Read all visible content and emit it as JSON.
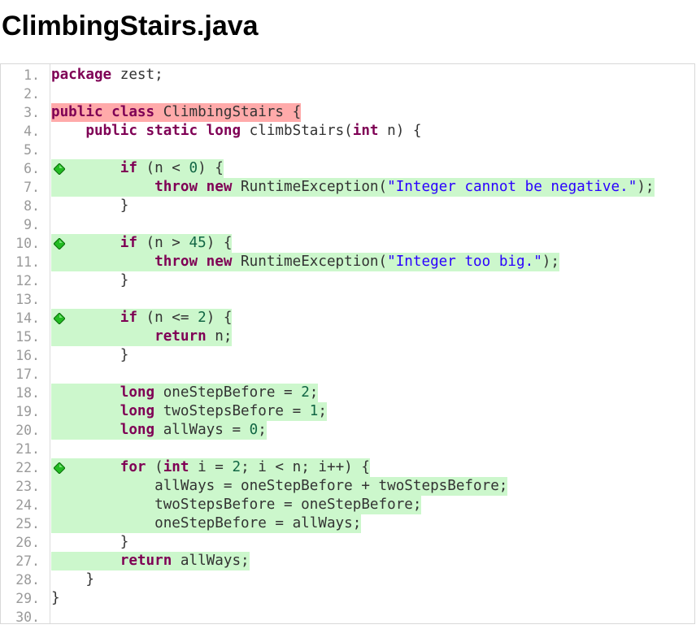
{
  "file": {
    "title": "ClimbingStairs.java"
  },
  "colors": {
    "covered": "#ccf7cc",
    "uncovered": "#ffaaaa",
    "keyword": "#7f0055",
    "string": "#2a00ff",
    "number": "#116644",
    "line_number": "#9a9a9a",
    "branch_marker": "#22bb22"
  },
  "lines": [
    {
      "n": "1.",
      "cov": "",
      "branch": false,
      "tokens": [
        [
          "kw",
          "package"
        ],
        [
          "t",
          " zest;"
        ]
      ]
    },
    {
      "n": "2.",
      "cov": "",
      "branch": false,
      "tokens": []
    },
    {
      "n": "3.",
      "cov": "partial",
      "branch": false,
      "tokens": [
        [
          "kw",
          "public class"
        ],
        [
          "t",
          " ClimbingStairs {"
        ]
      ]
    },
    {
      "n": "4.",
      "cov": "",
      "branch": false,
      "tokens": [
        [
          "t",
          "    "
        ],
        [
          "kw",
          "public static long"
        ],
        [
          "t",
          " climbStairs("
        ],
        [
          "kw",
          "int"
        ],
        [
          "t",
          " n) {"
        ]
      ]
    },
    {
      "n": "5.",
      "cov": "",
      "branch": false,
      "tokens": []
    },
    {
      "n": "6.",
      "cov": "full",
      "branch": true,
      "tokens": [
        [
          "t",
          "        "
        ],
        [
          "kw",
          "if"
        ],
        [
          "t",
          " (n < "
        ],
        [
          "num",
          "0"
        ],
        [
          "t",
          ") {"
        ]
      ]
    },
    {
      "n": "7.",
      "cov": "full",
      "branch": false,
      "tokens": [
        [
          "t",
          "            "
        ],
        [
          "kw",
          "throw new"
        ],
        [
          "t",
          " RuntimeException("
        ],
        [
          "str",
          "\"Integer cannot be negative.\""
        ],
        [
          "t",
          ");"
        ]
      ]
    },
    {
      "n": "8.",
      "cov": "",
      "branch": false,
      "tokens": [
        [
          "t",
          "        }"
        ]
      ]
    },
    {
      "n": "9.",
      "cov": "",
      "branch": false,
      "tokens": []
    },
    {
      "n": "10.",
      "cov": "full",
      "branch": true,
      "tokens": [
        [
          "t",
          "        "
        ],
        [
          "kw",
          "if"
        ],
        [
          "t",
          " (n > "
        ],
        [
          "num",
          "45"
        ],
        [
          "t",
          ") {"
        ]
      ]
    },
    {
      "n": "11.",
      "cov": "full",
      "branch": false,
      "tokens": [
        [
          "t",
          "            "
        ],
        [
          "kw",
          "throw new"
        ],
        [
          "t",
          " RuntimeException("
        ],
        [
          "str",
          "\"Integer too big.\""
        ],
        [
          "t",
          ");"
        ]
      ]
    },
    {
      "n": "12.",
      "cov": "",
      "branch": false,
      "tokens": [
        [
          "t",
          "        }"
        ]
      ]
    },
    {
      "n": "13.",
      "cov": "",
      "branch": false,
      "tokens": []
    },
    {
      "n": "14.",
      "cov": "full",
      "branch": true,
      "tokens": [
        [
          "t",
          "        "
        ],
        [
          "kw",
          "if"
        ],
        [
          "t",
          " (n <= "
        ],
        [
          "num",
          "2"
        ],
        [
          "t",
          ") {"
        ]
      ]
    },
    {
      "n": "15.",
      "cov": "full",
      "branch": false,
      "tokens": [
        [
          "t",
          "            "
        ],
        [
          "kw",
          "return"
        ],
        [
          "t",
          " n;"
        ]
      ]
    },
    {
      "n": "16.",
      "cov": "",
      "branch": false,
      "tokens": [
        [
          "t",
          "        }"
        ]
      ]
    },
    {
      "n": "17.",
      "cov": "",
      "branch": false,
      "tokens": []
    },
    {
      "n": "18.",
      "cov": "full",
      "branch": false,
      "tokens": [
        [
          "t",
          "        "
        ],
        [
          "kw",
          "long"
        ],
        [
          "t",
          " oneStepBefore = "
        ],
        [
          "num",
          "2"
        ],
        [
          "t",
          ";"
        ]
      ]
    },
    {
      "n": "19.",
      "cov": "full",
      "branch": false,
      "tokens": [
        [
          "t",
          "        "
        ],
        [
          "kw",
          "long"
        ],
        [
          "t",
          " twoStepsBefore = "
        ],
        [
          "num",
          "1"
        ],
        [
          "t",
          ";"
        ]
      ]
    },
    {
      "n": "20.",
      "cov": "full",
      "branch": false,
      "tokens": [
        [
          "t",
          "        "
        ],
        [
          "kw",
          "long"
        ],
        [
          "t",
          " allWays = "
        ],
        [
          "num",
          "0"
        ],
        [
          "t",
          ";"
        ]
      ]
    },
    {
      "n": "21.",
      "cov": "",
      "branch": false,
      "tokens": []
    },
    {
      "n": "22.",
      "cov": "full",
      "branch": true,
      "tokens": [
        [
          "t",
          "        "
        ],
        [
          "kw",
          "for"
        ],
        [
          "t",
          " ("
        ],
        [
          "kw",
          "int"
        ],
        [
          "t",
          " i = "
        ],
        [
          "num",
          "2"
        ],
        [
          "t",
          "; i < n; i++) {"
        ]
      ]
    },
    {
      "n": "23.",
      "cov": "full",
      "branch": false,
      "tokens": [
        [
          "t",
          "            allWays = oneStepBefore + twoStepsBefore;"
        ]
      ]
    },
    {
      "n": "24.",
      "cov": "full",
      "branch": false,
      "tokens": [
        [
          "t",
          "            twoStepsBefore = oneStepBefore;"
        ]
      ]
    },
    {
      "n": "25.",
      "cov": "full",
      "branch": false,
      "tokens": [
        [
          "t",
          "            oneStepBefore = allWays;"
        ]
      ]
    },
    {
      "n": "26.",
      "cov": "",
      "branch": false,
      "tokens": [
        [
          "t",
          "        }"
        ]
      ]
    },
    {
      "n": "27.",
      "cov": "full",
      "branch": false,
      "tokens": [
        [
          "t",
          "        "
        ],
        [
          "kw",
          "return"
        ],
        [
          "t",
          " allWays;"
        ]
      ]
    },
    {
      "n": "28.",
      "cov": "",
      "branch": false,
      "tokens": [
        [
          "t",
          "    }"
        ]
      ]
    },
    {
      "n": "29.",
      "cov": "",
      "branch": false,
      "tokens": [
        [
          "t",
          "}"
        ]
      ]
    },
    {
      "n": "30.",
      "cov": "",
      "branch": false,
      "tokens": []
    }
  ]
}
